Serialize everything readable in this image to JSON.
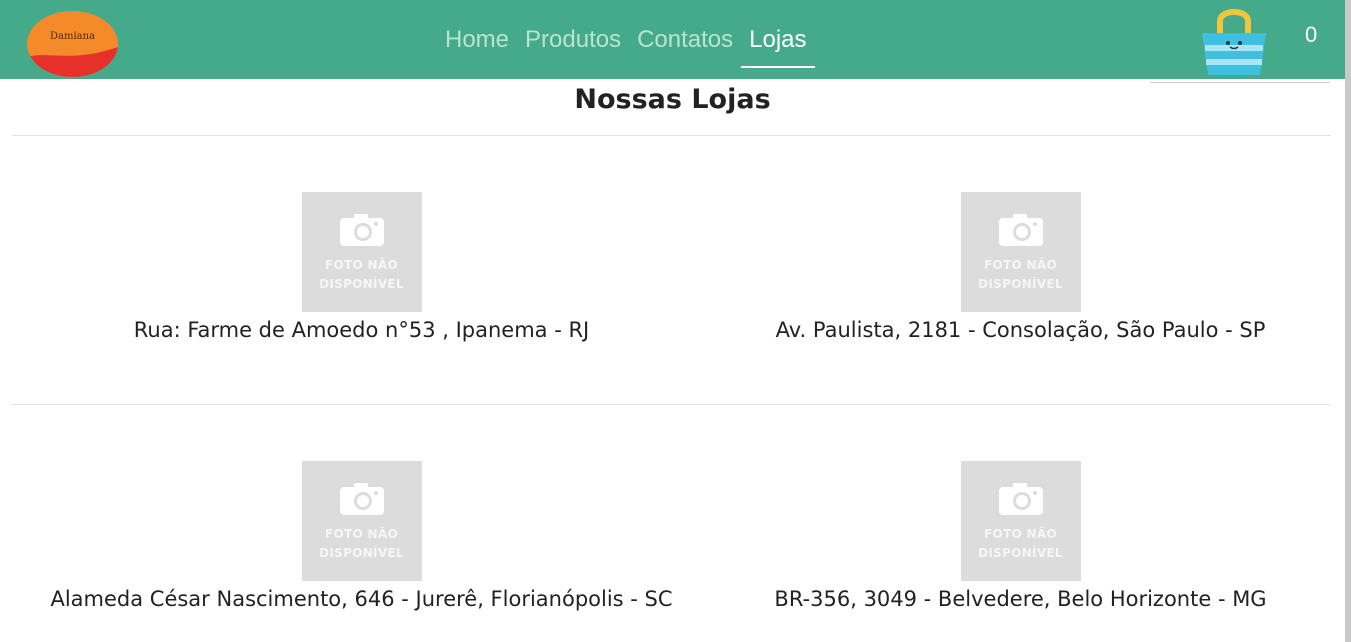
{
  "navbar": {
    "logo_text": "Damiana",
    "links": [
      {
        "label": "Home"
      },
      {
        "label": "Produtos"
      },
      {
        "label": "Contatos"
      },
      {
        "label": "Lojas"
      }
    ],
    "active_link": "Lojas",
    "cart_count": "0",
    "background_color": "#44aa8a"
  },
  "page": {
    "title": "Nossas Lojas"
  },
  "stores": [
    {
      "photo_text_line1": "FOTO NÃO",
      "photo_text_line2": "DISPONÍVEL",
      "address": "Rua: Farme de Amoedo n°53 , Ipanema - RJ"
    },
    {
      "photo_text_line1": "FOTO NÃO",
      "photo_text_line2": "DISPONÍVEL",
      "address": "Av. Paulista, 2181 - Consolação, São Paulo - SP"
    },
    {
      "photo_text_line1": "FOTO NÃO",
      "photo_text_line2": "DISPONÍVEL",
      "address": "Alameda César Nascimento, 646 - Jurerê, Florianópolis - SC"
    },
    {
      "photo_text_line1": "FOTO NÃO",
      "photo_text_line2": "DISPONÍVEL",
      "address": "BR-356, 3049 - Belvedere, Belo Horizonte - MG"
    }
  ]
}
